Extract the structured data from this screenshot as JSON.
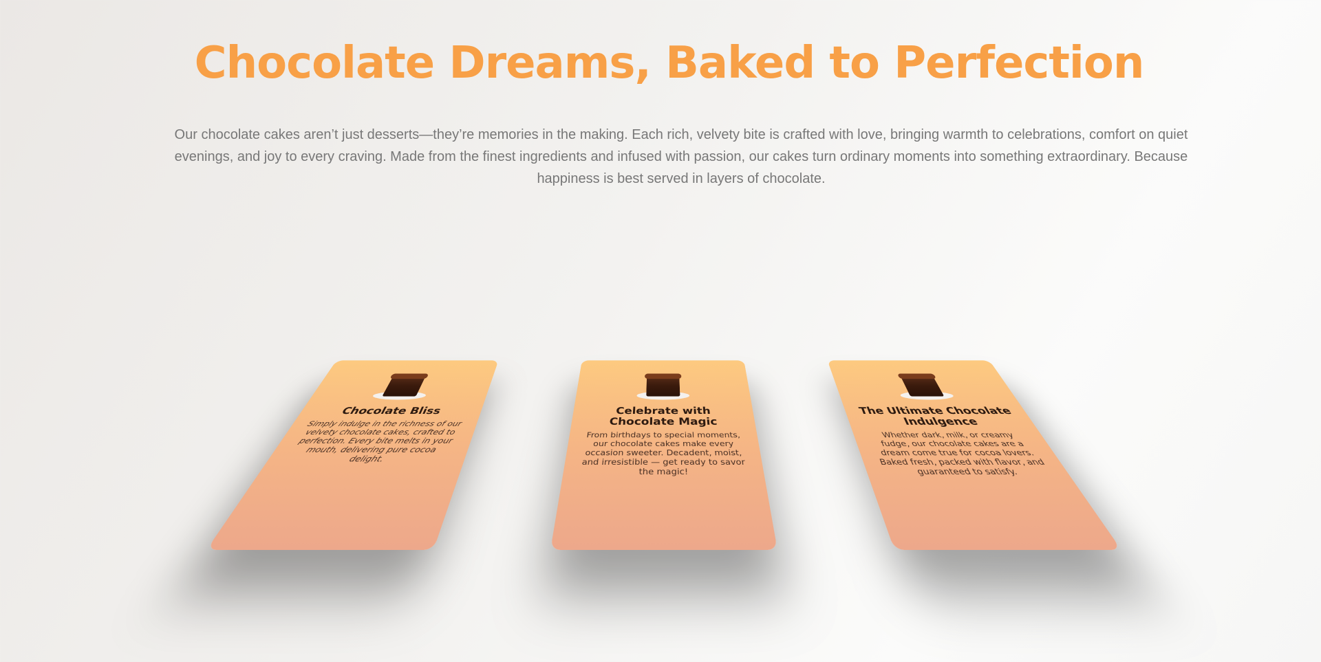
{
  "hero": {
    "title": "Chocolate Dreams, Baked to Perfection",
    "description": "Our chocolate cakes aren’t just desserts—they’re memories in the making. Each rich, velvety bite is crafted with love, bringing warmth to celebrations, comfort on quiet evenings, and joy to every craving. Made from the finest ingredients and infused with passion, our cakes turn ordinary moments into something extraordinary. Because happiness is best served in layers of chocolate."
  },
  "cards": [
    {
      "title": "Chocolate Bliss",
      "text": "Simply indulge in the richness of our velvety chocolate cakes, crafted to perfection. Every bite melts in your mouth, delivering pure cocoa delight."
    },
    {
      "title": "Celebrate with Chocolate Magic",
      "text": "From birthdays to special moments, our chocolate cakes make every occasion sweeter. Decadent, moist, and irresistible — get ready to savor the magic!"
    },
    {
      "title": "The Ultimate Chocolate Indulgence",
      "text": "Whether dark, milk, or creamy fudge, our chocolate cakes are a dream come true for cocoa lovers. Baked fresh, packed with flavor, and guaranteed to satisfy."
    }
  ],
  "colors": {
    "title": "#f8a047",
    "card_top": "#fdca80",
    "card_bottom": "#eda88b"
  }
}
